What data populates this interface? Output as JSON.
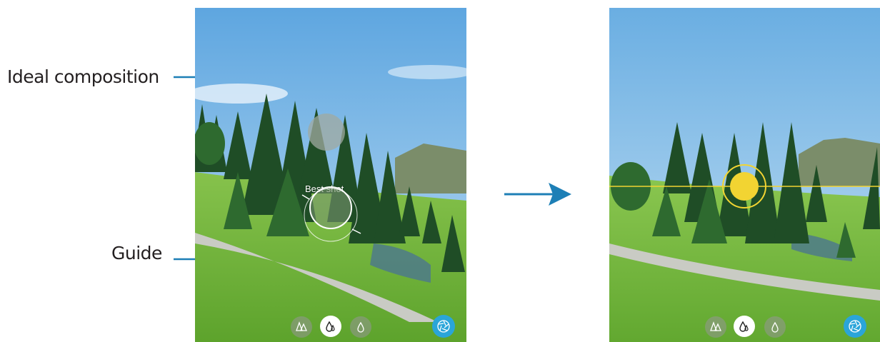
{
  "callouts": {
    "ideal_composition": "Ideal composition",
    "guide": "Guide"
  },
  "left_screen": {
    "hint_text": "Best shot",
    "modes": [
      {
        "icon": "trees-icon",
        "selected": false
      },
      {
        "icon": "drops-icon",
        "selected": true
      },
      {
        "icon": "drop-icon",
        "selected": false
      }
    ]
  },
  "right_screen": {
    "modes": [
      {
        "icon": "trees-icon",
        "selected": false
      },
      {
        "icon": "drops-icon",
        "selected": true
      },
      {
        "icon": "drop-icon",
        "selected": false
      }
    ]
  },
  "colors": {
    "callout_line": "#1d7fb6",
    "arrow": "#1d7fb6",
    "sky": "#9ccbe9",
    "grass": "#6bb33c",
    "indicator_yellow": "#f2d432",
    "shutter": "#2aa5d9"
  }
}
